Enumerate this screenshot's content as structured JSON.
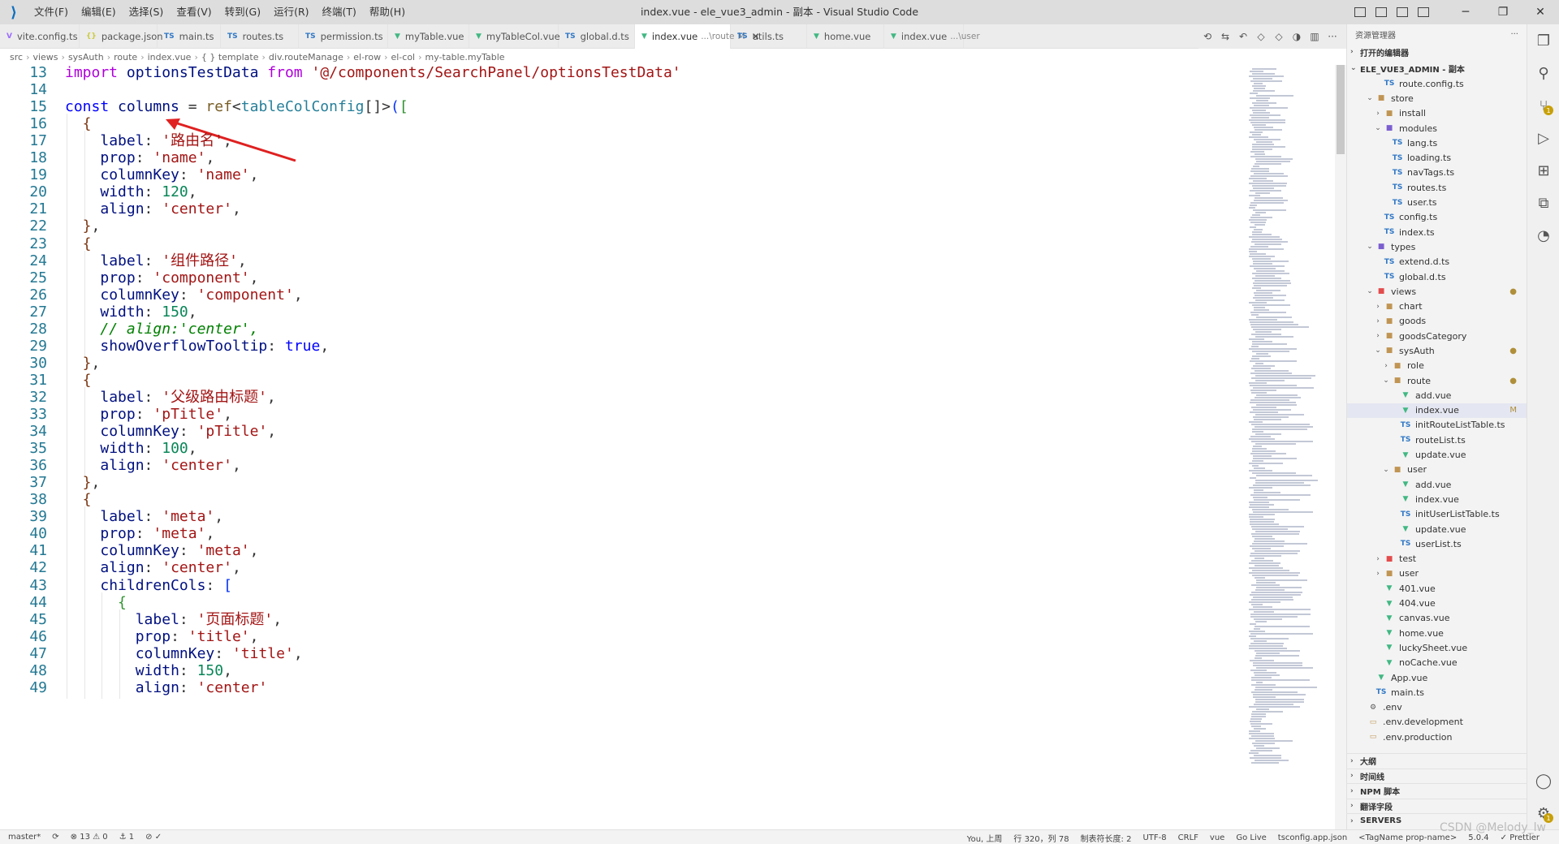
{
  "window": {
    "title": "index.vue - ele_vue3_admin - 副本 - Visual Studio Code",
    "menu": [
      "文件(F)",
      "编辑(E)",
      "选择(S)",
      "查看(V)",
      "转到(G)",
      "运行(R)",
      "终端(T)",
      "帮助(H)"
    ],
    "controls": {
      "minimize": "─",
      "maximize": "❐",
      "close": "✕"
    }
  },
  "tabs": [
    {
      "label": "vite.config.ts",
      "icon": "V",
      "kind": "vite"
    },
    {
      "label": "package.json",
      "icon": "{}",
      "kind": "json"
    },
    {
      "label": "main.ts",
      "icon": "TS",
      "kind": "ts"
    },
    {
      "label": "routes.ts",
      "icon": "TS",
      "kind": "ts"
    },
    {
      "label": "permission.ts",
      "icon": "TS",
      "kind": "ts"
    },
    {
      "label": "myTable.vue",
      "icon": "▼",
      "kind": "vue"
    },
    {
      "label": "myTableCol.vue",
      "icon": "▼",
      "kind": "vue"
    },
    {
      "label": "global.d.ts",
      "icon": "TS",
      "kind": "ts"
    },
    {
      "label": "index.vue",
      "icon": "▼",
      "kind": "vue",
      "active": true,
      "desc": "...\\route",
      "mod": "M",
      "close": "✕"
    },
    {
      "label": "utils.ts",
      "icon": "TS",
      "kind": "ts"
    },
    {
      "label": "home.vue",
      "icon": "▼",
      "kind": "vue"
    },
    {
      "label": "index.vue",
      "icon": "▼",
      "kind": "vue",
      "desc": "...\\user"
    }
  ],
  "breadcrumb": [
    "src",
    "views",
    "sysAuth",
    "route",
    "index.vue",
    "{ } template",
    "div.routeManage",
    "el-row",
    "el-col",
    "my-table.myTable"
  ],
  "code_lines": [
    {
      "n": "13",
      "indent": 0,
      "toks": [
        [
          "import",
          "kw2"
        ],
        [
          " ",
          "plain"
        ],
        [
          "optionsTestData",
          "var"
        ],
        [
          " ",
          "plain"
        ],
        [
          "from",
          "kw2"
        ],
        [
          " ",
          "plain"
        ],
        [
          "'@/components/SearchPanel/optionsTestData'",
          "str"
        ]
      ]
    },
    {
      "n": "14",
      "indent": 0,
      "toks": []
    },
    {
      "n": "15",
      "indent": 0,
      "toks": [
        [
          "const",
          "kw"
        ],
        [
          " ",
          "plain"
        ],
        [
          "columns",
          "var"
        ],
        [
          " = ",
          "plain"
        ],
        [
          "ref",
          "fn"
        ],
        [
          "<",
          "plain"
        ],
        [
          "tableColConfig",
          "type"
        ],
        [
          "[]>",
          "plain"
        ],
        [
          "(",
          "br1"
        ],
        [
          "[",
          "br2"
        ]
      ]
    },
    {
      "n": "16",
      "indent": 1,
      "toks": [
        [
          "{",
          "br3"
        ]
      ]
    },
    {
      "n": "17",
      "indent": 2,
      "toks": [
        [
          "label",
          "var"
        ],
        [
          ": ",
          "plain"
        ],
        [
          "'路由名'",
          "str"
        ],
        [
          ",",
          "plain"
        ]
      ]
    },
    {
      "n": "18",
      "indent": 2,
      "toks": [
        [
          "prop",
          "var"
        ],
        [
          ": ",
          "plain"
        ],
        [
          "'name'",
          "str"
        ],
        [
          ",",
          "plain"
        ]
      ]
    },
    {
      "n": "19",
      "indent": 2,
      "toks": [
        [
          "columnKey",
          "var"
        ],
        [
          ": ",
          "plain"
        ],
        [
          "'name'",
          "str"
        ],
        [
          ",",
          "plain"
        ]
      ]
    },
    {
      "n": "20",
      "indent": 2,
      "toks": [
        [
          "width",
          "var"
        ],
        [
          ": ",
          "plain"
        ],
        [
          "120",
          "num"
        ],
        [
          ",",
          "plain"
        ]
      ]
    },
    {
      "n": "21",
      "indent": 2,
      "toks": [
        [
          "align",
          "var"
        ],
        [
          ": ",
          "plain"
        ],
        [
          "'center'",
          "str"
        ],
        [
          ",",
          "plain"
        ]
      ]
    },
    {
      "n": "22",
      "indent": 1,
      "toks": [
        [
          "}",
          "br3"
        ],
        [
          ",",
          "plain"
        ]
      ]
    },
    {
      "n": "23",
      "indent": 1,
      "toks": [
        [
          "{",
          "br3"
        ]
      ]
    },
    {
      "n": "24",
      "indent": 2,
      "toks": [
        [
          "label",
          "var"
        ],
        [
          ": ",
          "plain"
        ],
        [
          "'组件路径'",
          "str"
        ],
        [
          ",",
          "plain"
        ]
      ]
    },
    {
      "n": "25",
      "indent": 2,
      "toks": [
        [
          "prop",
          "var"
        ],
        [
          ": ",
          "plain"
        ],
        [
          "'component'",
          "str"
        ],
        [
          ",",
          "plain"
        ]
      ]
    },
    {
      "n": "26",
      "indent": 2,
      "toks": [
        [
          "columnKey",
          "var"
        ],
        [
          ": ",
          "plain"
        ],
        [
          "'component'",
          "str"
        ],
        [
          ",",
          "plain"
        ]
      ]
    },
    {
      "n": "27",
      "indent": 2,
      "toks": [
        [
          "width",
          "var"
        ],
        [
          ": ",
          "plain"
        ],
        [
          "150",
          "num"
        ],
        [
          ",",
          "plain"
        ]
      ]
    },
    {
      "n": "28",
      "indent": 2,
      "toks": [
        [
          "// align:'center',",
          "com"
        ]
      ]
    },
    {
      "n": "29",
      "indent": 2,
      "toks": [
        [
          "showOverflowTooltip",
          "var"
        ],
        [
          ": ",
          "plain"
        ],
        [
          "true",
          "bool"
        ],
        [
          ",",
          "plain"
        ]
      ]
    },
    {
      "n": "30",
      "indent": 1,
      "toks": [
        [
          "}",
          "br3"
        ],
        [
          ",",
          "plain"
        ]
      ]
    },
    {
      "n": "31",
      "indent": 1,
      "toks": [
        [
          "{",
          "br3"
        ]
      ]
    },
    {
      "n": "32",
      "indent": 2,
      "toks": [
        [
          "label",
          "var"
        ],
        [
          ": ",
          "plain"
        ],
        [
          "'父级路由标题'",
          "str"
        ],
        [
          ",",
          "plain"
        ]
      ]
    },
    {
      "n": "33",
      "indent": 2,
      "toks": [
        [
          "prop",
          "var"
        ],
        [
          ": ",
          "plain"
        ],
        [
          "'pTitle'",
          "str"
        ],
        [
          ",",
          "plain"
        ]
      ]
    },
    {
      "n": "34",
      "indent": 2,
      "toks": [
        [
          "columnKey",
          "var"
        ],
        [
          ": ",
          "plain"
        ],
        [
          "'pTitle'",
          "str"
        ],
        [
          ",",
          "plain"
        ]
      ]
    },
    {
      "n": "35",
      "indent": 2,
      "toks": [
        [
          "width",
          "var"
        ],
        [
          ": ",
          "plain"
        ],
        [
          "100",
          "num"
        ],
        [
          ",",
          "plain"
        ]
      ]
    },
    {
      "n": "36",
      "indent": 2,
      "toks": [
        [
          "align",
          "var"
        ],
        [
          ": ",
          "plain"
        ],
        [
          "'center'",
          "str"
        ],
        [
          ",",
          "plain"
        ]
      ]
    },
    {
      "n": "37",
      "indent": 1,
      "toks": [
        [
          "}",
          "br3"
        ],
        [
          ",",
          "plain"
        ]
      ]
    },
    {
      "n": "38",
      "indent": 1,
      "toks": [
        [
          "{",
          "br3"
        ]
      ]
    },
    {
      "n": "39",
      "indent": 2,
      "toks": [
        [
          "label",
          "var"
        ],
        [
          ": ",
          "plain"
        ],
        [
          "'meta'",
          "str"
        ],
        [
          ",",
          "plain"
        ]
      ]
    },
    {
      "n": "40",
      "indent": 2,
      "toks": [
        [
          "prop",
          "var"
        ],
        [
          ": ",
          "plain"
        ],
        [
          "'meta'",
          "str"
        ],
        [
          ",",
          "plain"
        ]
      ]
    },
    {
      "n": "41",
      "indent": 2,
      "toks": [
        [
          "columnKey",
          "var"
        ],
        [
          ": ",
          "plain"
        ],
        [
          "'meta'",
          "str"
        ],
        [
          ",",
          "plain"
        ]
      ]
    },
    {
      "n": "42",
      "indent": 2,
      "toks": [
        [
          "align",
          "var"
        ],
        [
          ": ",
          "plain"
        ],
        [
          "'center'",
          "str"
        ],
        [
          ",",
          "plain"
        ]
      ]
    },
    {
      "n": "43",
      "indent": 2,
      "toks": [
        [
          "childrenCols",
          "var"
        ],
        [
          ": ",
          "plain"
        ],
        [
          "[",
          "br1"
        ]
      ]
    },
    {
      "n": "44",
      "indent": 3,
      "toks": [
        [
          "{",
          "br2"
        ]
      ]
    },
    {
      "n": "45",
      "indent": 4,
      "toks": [
        [
          "label",
          "var"
        ],
        [
          ": ",
          "plain"
        ],
        [
          "'页面标题'",
          "str"
        ],
        [
          ",",
          "plain"
        ]
      ]
    },
    {
      "n": "46",
      "indent": 4,
      "toks": [
        [
          "prop",
          "var"
        ],
        [
          ": ",
          "plain"
        ],
        [
          "'title'",
          "str"
        ],
        [
          ",",
          "plain"
        ]
      ]
    },
    {
      "n": "47",
      "indent": 4,
      "toks": [
        [
          "columnKey",
          "var"
        ],
        [
          ": ",
          "plain"
        ],
        [
          "'title'",
          "str"
        ],
        [
          ",",
          "plain"
        ]
      ]
    },
    {
      "n": "48",
      "indent": 4,
      "toks": [
        [
          "width",
          "var"
        ],
        [
          ": ",
          "plain"
        ],
        [
          "150",
          "num"
        ],
        [
          ",",
          "plain"
        ]
      ]
    },
    {
      "n": "49",
      "indent": 4,
      "toks": [
        [
          "align",
          "var"
        ],
        [
          ": ",
          "plain"
        ],
        [
          "'center'",
          "str"
        ]
      ]
    }
  ],
  "explorer": {
    "header": "资源管理器",
    "more": "···",
    "open_editors": "打开的编辑器",
    "workspace": "ELE_VUE3_ADMIN - 副本",
    "tree": [
      {
        "label": "route.config.ts",
        "depth": 2,
        "icon": "TS",
        "kind": "ts"
      },
      {
        "label": "store",
        "depth": 1,
        "icon": "■",
        "kind": "folder",
        "arrow": "⌄"
      },
      {
        "label": "install",
        "depth": 2,
        "icon": "■",
        "kind": "folder",
        "arrow": "›"
      },
      {
        "label": "modules",
        "depth": 2,
        "icon": "■",
        "kind": "folder-special",
        "arrow": "⌄"
      },
      {
        "label": "lang.ts",
        "depth": 3,
        "icon": "TS",
        "kind": "ts"
      },
      {
        "label": "loading.ts",
        "depth": 3,
        "icon": "TS",
        "kind": "ts"
      },
      {
        "label": "navTags.ts",
        "depth": 3,
        "icon": "TS",
        "kind": "ts"
      },
      {
        "label": "routes.ts",
        "depth": 3,
        "icon": "TS",
        "kind": "ts"
      },
      {
        "label": "user.ts",
        "depth": 3,
        "icon": "TS",
        "kind": "ts"
      },
      {
        "label": "config.ts",
        "depth": 2,
        "icon": "TS",
        "kind": "ts"
      },
      {
        "label": "index.ts",
        "depth": 2,
        "icon": "TS",
        "kind": "ts"
      },
      {
        "label": "types",
        "depth": 1,
        "icon": "■",
        "kind": "folder-special",
        "arrow": "⌄"
      },
      {
        "label": "extend.d.ts",
        "depth": 2,
        "icon": "TS",
        "kind": "ts"
      },
      {
        "label": "global.d.ts",
        "depth": 2,
        "icon": "TS",
        "kind": "ts"
      },
      {
        "label": "views",
        "depth": 1,
        "icon": "■",
        "kind": "folder-red",
        "arrow": "⌄",
        "status": "●"
      },
      {
        "label": "chart",
        "depth": 2,
        "icon": "■",
        "kind": "folder",
        "arrow": "›"
      },
      {
        "label": "goods",
        "depth": 2,
        "icon": "■",
        "kind": "folder",
        "arrow": "›"
      },
      {
        "label": "goodsCategory",
        "depth": 2,
        "icon": "■",
        "kind": "folder",
        "arrow": "›"
      },
      {
        "label": "sysAuth",
        "depth": 2,
        "icon": "■",
        "kind": "folder",
        "arrow": "⌄",
        "status": "●"
      },
      {
        "label": "role",
        "depth": 3,
        "icon": "■",
        "kind": "folder",
        "arrow": "›"
      },
      {
        "label": "route",
        "depth": 3,
        "icon": "■",
        "kind": "folder",
        "arrow": "⌄",
        "status": "●"
      },
      {
        "label": "add.vue",
        "depth": 4,
        "icon": "▼",
        "kind": "vue"
      },
      {
        "label": "index.vue",
        "depth": 4,
        "icon": "▼",
        "kind": "vue",
        "selected": true,
        "status": "M"
      },
      {
        "label": "initRouteListTable.ts",
        "depth": 4,
        "icon": "TS",
        "kind": "ts"
      },
      {
        "label": "routeList.ts",
        "depth": 4,
        "icon": "TS",
        "kind": "ts"
      },
      {
        "label": "update.vue",
        "depth": 4,
        "icon": "▼",
        "kind": "vue"
      },
      {
        "label": "user",
        "depth": 3,
        "icon": "■",
        "kind": "folder",
        "arrow": "⌄"
      },
      {
        "label": "add.vue",
        "depth": 4,
        "icon": "▼",
        "kind": "vue"
      },
      {
        "label": "index.vue",
        "depth": 4,
        "icon": "▼",
        "kind": "vue"
      },
      {
        "label": "initUserListTable.ts",
        "depth": 4,
        "icon": "TS",
        "kind": "ts"
      },
      {
        "label": "update.vue",
        "depth": 4,
        "icon": "▼",
        "kind": "vue"
      },
      {
        "label": "userList.ts",
        "depth": 4,
        "icon": "TS",
        "kind": "ts"
      },
      {
        "label": "test",
        "depth": 2,
        "icon": "■",
        "kind": "folder-red",
        "arrow": "›"
      },
      {
        "label": "user",
        "depth": 2,
        "icon": "■",
        "kind": "folder",
        "arrow": "›"
      },
      {
        "label": "401.vue",
        "depth": 2,
        "icon": "▼",
        "kind": "vue"
      },
      {
        "label": "404.vue",
        "depth": 2,
        "icon": "▼",
        "kind": "vue"
      },
      {
        "label": "canvas.vue",
        "depth": 2,
        "icon": "▼",
        "kind": "vue"
      },
      {
        "label": "home.vue",
        "depth": 2,
        "icon": "▼",
        "kind": "vue"
      },
      {
        "label": "luckySheet.vue",
        "depth": 2,
        "icon": "▼",
        "kind": "vue"
      },
      {
        "label": "noCache.vue",
        "depth": 2,
        "icon": "▼",
        "kind": "vue"
      },
      {
        "label": "App.vue",
        "depth": 1,
        "icon": "▼",
        "kind": "vue"
      },
      {
        "label": "main.ts",
        "depth": 1,
        "icon": "TS",
        "kind": "ts"
      },
      {
        "label": ".env",
        "depth": 0,
        "icon": "⚙",
        "kind": "gear"
      },
      {
        "label": ".env.development",
        "depth": 0,
        "icon": "▭",
        "kind": "env"
      },
      {
        "label": ".env.production",
        "depth": 0,
        "icon": "▭",
        "kind": "env"
      }
    ],
    "bottom_sections": [
      "大纲",
      "时间线",
      "NPM 脚本",
      "翻译字段",
      "SERVERS"
    ]
  },
  "activity": {
    "scm_badge": "1",
    "settings_badge": "1"
  },
  "status": {
    "branch": "master*",
    "sync": "⟳",
    "errors": "⊗ 13 ⚠ 0",
    "ports": "⚓ 1",
    "misc": "⊘ ✓",
    "blame": "You, 上周",
    "position": "行 320，列 78",
    "tab_size": "制表符长度: 2",
    "encoding": "UTF-8",
    "eol": "CRLF",
    "language": "vue",
    "golive": "Go Live",
    "tsconfig": "tsconfig.app.json",
    "tag": "<TagName prop-name>",
    "version": "5.0.4",
    "prettier": "✓ Prettier"
  },
  "watermark": "CSDN @Melody_lw",
  "colors": {
    "accent": "#0e6fbf",
    "string": "#a31515",
    "number": "#098658",
    "arrow": "#e02020"
  }
}
